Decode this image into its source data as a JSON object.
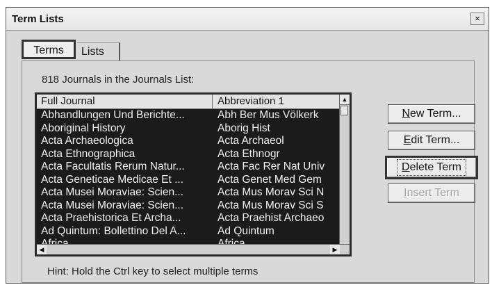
{
  "window": {
    "title": "Term Lists",
    "close_glyph": "×"
  },
  "tabs": [
    {
      "label": "Terms",
      "active": true
    },
    {
      "label": "Lists",
      "active": false
    }
  ],
  "list": {
    "count_label": "818 Journals in the Journals List:",
    "columns": [
      "Full Journal",
      "Abbreviation 1"
    ],
    "rows": [
      [
        "Abhandlungen Und Berichte...",
        "Abh Ber Mus Völkerk"
      ],
      [
        "Aboriginal History",
        "Aborig Hist"
      ],
      [
        "Acta Archaeologica",
        "Acta Archaeol"
      ],
      [
        "Acta Ethnographica",
        "Acta Ethnogr"
      ],
      [
        "Acta Facultatis Rerum Natur...",
        "Acta Fac Rer Nat Univ"
      ],
      [
        "Acta Geneticae Medicae Et ...",
        "Acta Genet Med Gem"
      ],
      [
        "Acta Musei Moraviae: Scien...",
        "Acta Mus Morav Sci N"
      ],
      [
        "Acta Musei Moraviae: Scien...",
        "Acta Mus Morav Sci S"
      ],
      [
        "Acta Praehistorica Et Archa...",
        "Acta Praehist Archaeo"
      ],
      [
        "Ad Quintum: Bollettino Del A...",
        "Ad Quintum"
      ],
      [
        "Africa",
        "Africa"
      ]
    ],
    "selected_color": "#1b1b1b"
  },
  "buttons": {
    "new_term": {
      "first": "N",
      "rest": "ew Term..."
    },
    "edit_term": {
      "first": "E",
      "rest": "dit Term..."
    },
    "delete_term": {
      "first": "D",
      "rest": "elete Term"
    },
    "insert_term": {
      "first": "I",
      "rest": "nsert Term",
      "disabled": true
    }
  },
  "hint": "Hint: Hold the Ctrl key to select multiple terms",
  "icons": {
    "close": "close-icon",
    "scroll_up": "arrow-up-icon",
    "scroll_left": "arrow-left-icon",
    "scroll_right": "arrow-right-icon"
  }
}
